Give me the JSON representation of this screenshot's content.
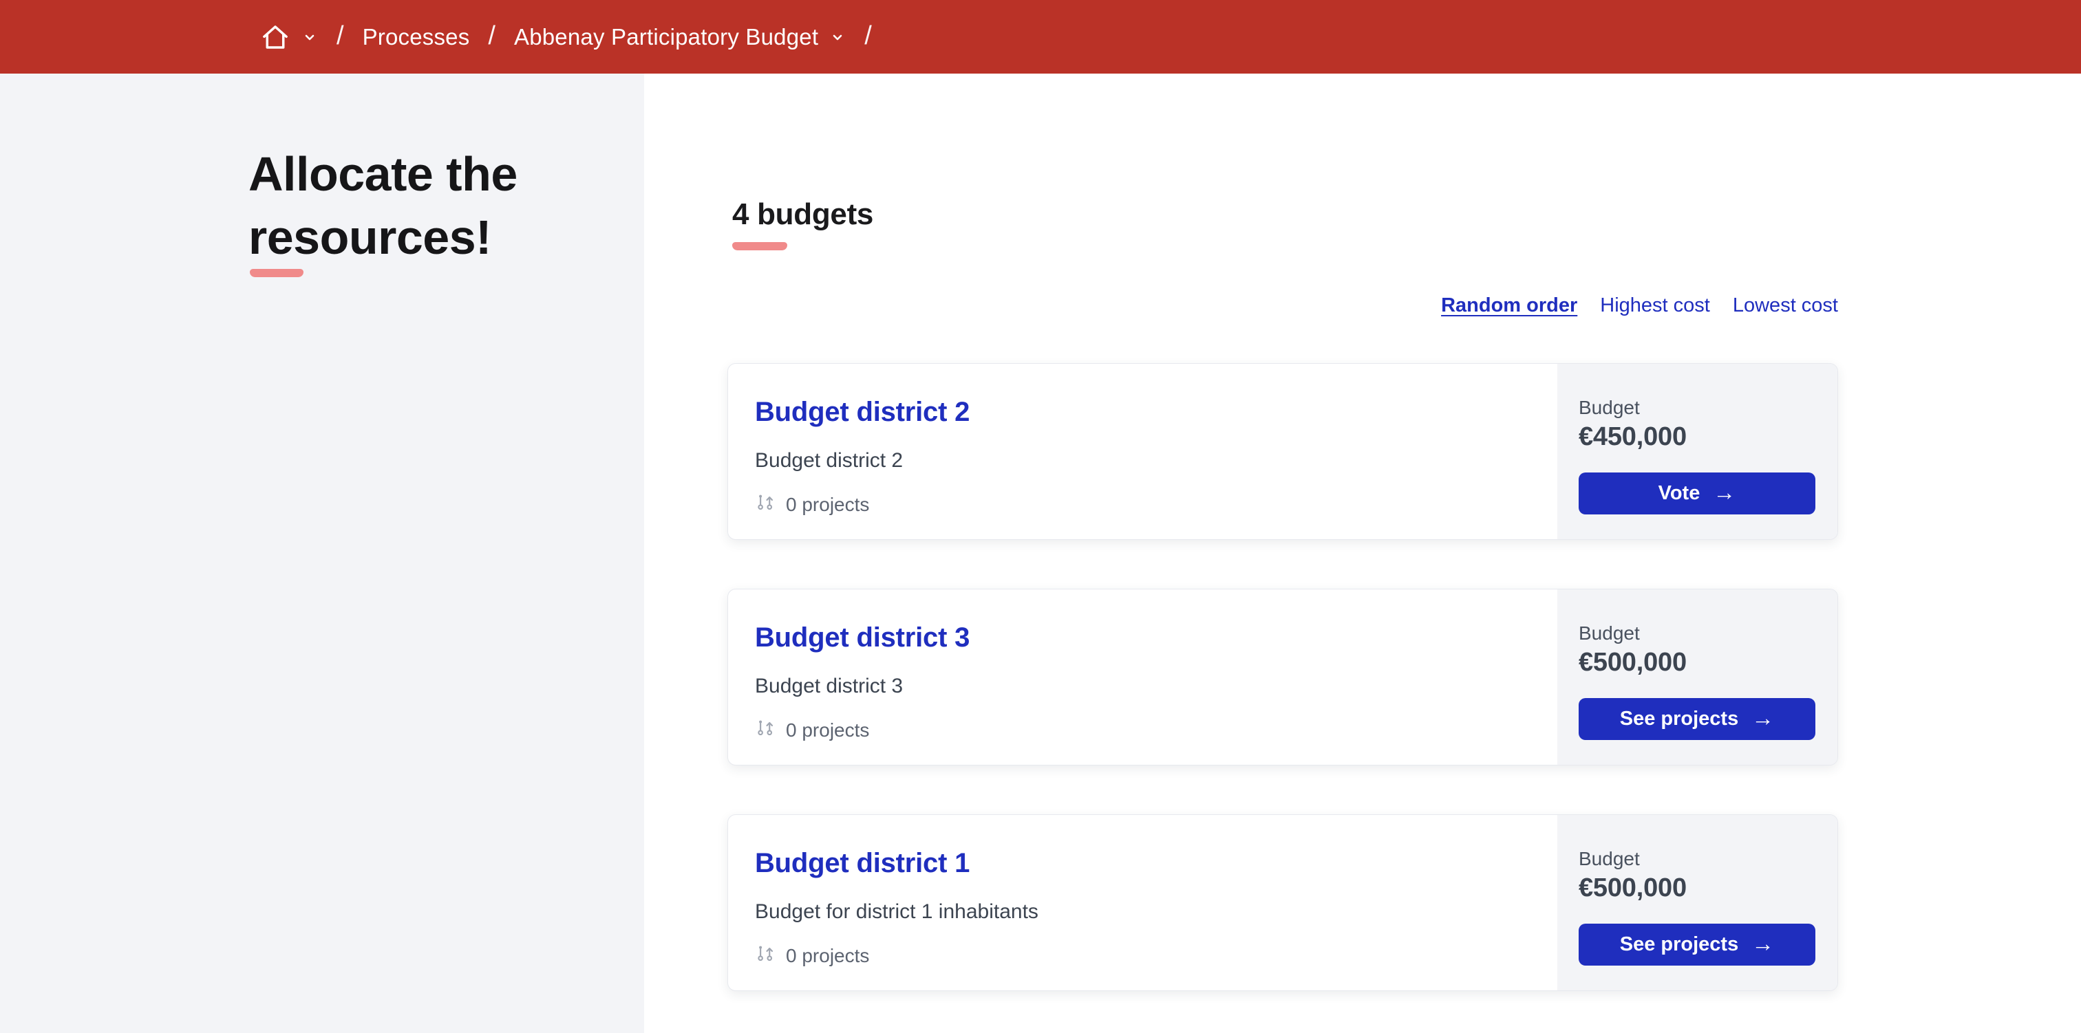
{
  "colors": {
    "header_background": "#ba3227",
    "accent_blue": "#1f2ebe",
    "underline_salmon": "#f08a8a",
    "panel_gray": "#f3f4f7",
    "heading_text": "#161618",
    "body_text": "#3c4450",
    "muted_text": "#5c6370"
  },
  "breadcrumb": {
    "separator": "/",
    "items": [
      {
        "label": "Processes"
      },
      {
        "label": "Abbenay Participatory Budget"
      }
    ]
  },
  "sidebar": {
    "heading": "Allocate the resources!"
  },
  "main": {
    "heading": "4 budgets",
    "arrow_glyph": "→",
    "sort": {
      "options": [
        {
          "label": "Random order",
          "active": true
        },
        {
          "label": "Highest cost",
          "active": false
        },
        {
          "label": "Lowest cost",
          "active": false
        }
      ]
    },
    "cards": [
      {
        "title": "Budget district 2",
        "description": "Budget district 2",
        "projects": "0 projects",
        "budget_label": "Budget",
        "amount": "€450,000",
        "action": "Vote"
      },
      {
        "title": "Budget district 3",
        "description": "Budget district 3",
        "projects": "0 projects",
        "budget_label": "Budget",
        "amount": "€500,000",
        "action": "See projects"
      },
      {
        "title": "Budget district 1",
        "description": "Budget for district 1 inhabitants",
        "projects": "0 projects",
        "budget_label": "Budget",
        "amount": "€500,000",
        "action": "See projects"
      }
    ]
  }
}
